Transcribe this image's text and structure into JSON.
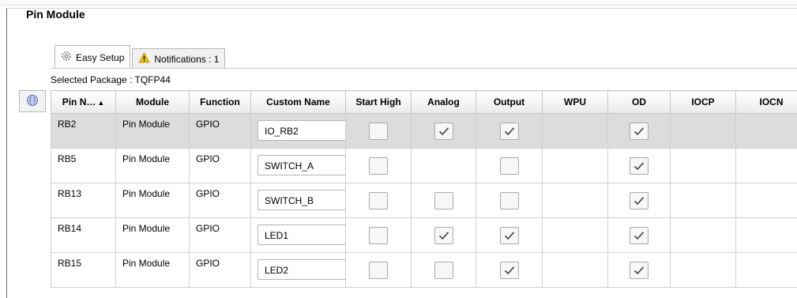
{
  "module_title": "Pin Module",
  "tabs": [
    {
      "label": "Easy Setup",
      "icon": "gear-icon"
    },
    {
      "label": "Notifications : 1",
      "icon": "warning-icon"
    }
  ],
  "package_label": "Selected Package : TQFP44",
  "table": {
    "columns": [
      "Pin N…",
      "Module",
      "Function",
      "Custom Name",
      "Start High",
      "Analog",
      "Output",
      "WPU",
      "OD",
      "IOCP",
      "IOCN"
    ],
    "sort_indicator": "▲",
    "rows": [
      {
        "pin": "RB2",
        "module": "Pin Module",
        "function": "GPIO",
        "custom_name": "IO_RB2",
        "start_high": false,
        "analog": true,
        "output": true,
        "od": true,
        "selected": true
      },
      {
        "pin": "RB5",
        "module": "Pin Module",
        "function": "GPIO",
        "custom_name": "SWITCH_A",
        "start_high": false,
        "analog": null,
        "output": false,
        "od": true,
        "selected": false
      },
      {
        "pin": "RB13",
        "module": "Pin Module",
        "function": "GPIO",
        "custom_name": "SWITCH_B",
        "start_high": false,
        "analog": false,
        "output": false,
        "od": true,
        "selected": false
      },
      {
        "pin": "RB14",
        "module": "Pin Module",
        "function": "GPIO",
        "custom_name": "LED1",
        "start_high": false,
        "analog": true,
        "output": true,
        "od": true,
        "selected": false
      },
      {
        "pin": "RB15",
        "module": "Pin Module",
        "function": "GPIO",
        "custom_name": "LED2",
        "start_high": false,
        "analog": false,
        "output": true,
        "od": true,
        "selected": false
      }
    ]
  },
  "colors": {
    "selected_row": "#dcdcdc",
    "warning": "#f2c400"
  }
}
